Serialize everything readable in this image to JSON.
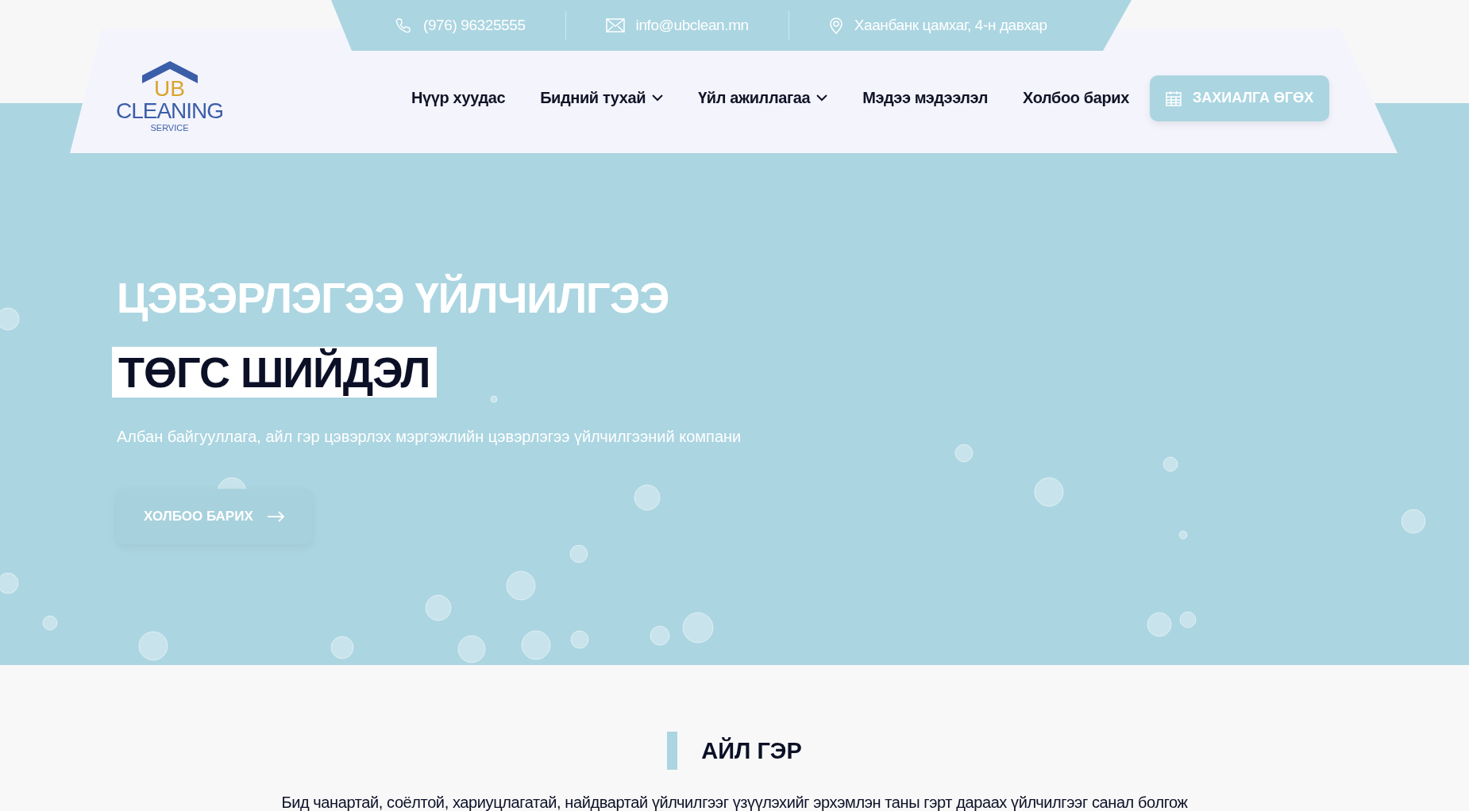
{
  "topbar": {
    "phone": "(976) 96325555",
    "email": "info@ubclean.mn",
    "address": "Хаанбанк цамхаг, 4-н давхар"
  },
  "logo": {
    "top": "UB",
    "main": "CLEANING",
    "sub": "SERVICE"
  },
  "nav": [
    {
      "label": "Нүүр хуудас",
      "dropdown": false
    },
    {
      "label": "Бидний тухай",
      "dropdown": true
    },
    {
      "label": "Үйл ажиллагаа",
      "dropdown": true
    },
    {
      "label": "Мэдээ мэдээлэл",
      "dropdown": false
    },
    {
      "label": "Холбоо барих",
      "dropdown": false
    }
  ],
  "order_button": "ЗАХИАЛГА ӨГӨХ",
  "hero": {
    "title": "ЦЭВЭРЛЭГЭЭ ҮЙЛЧИЛГЭЭ",
    "highlight": "ТӨГС ШИЙДЭЛ",
    "subtitle": "Албан байгууллага, айл гэр цэвэрлэх мэргэжлийн цэвэрлэгээ үйлчилгээний компани",
    "button": "ХОЛБОО БАРИХ"
  },
  "section": {
    "title": "АЙЛ ГЭР",
    "text": "Бид чанартай, соёлтой, хариуцлагатай, найдвартай үйлчилгээг үзүүлэхийг эрхэмлэн таны гэрт дараах үйлчилгээг санал болгож"
  }
}
